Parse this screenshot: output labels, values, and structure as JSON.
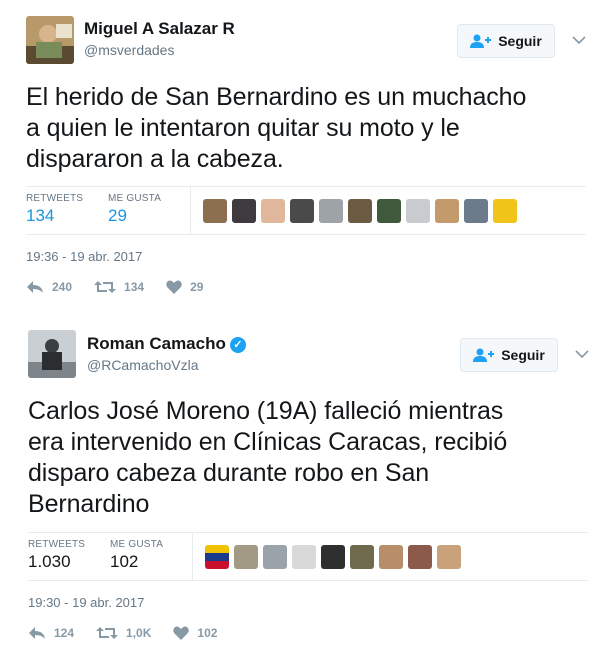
{
  "tweets": [
    {
      "name": "Miguel A Salazar R",
      "handle": "@msverdades",
      "verified": false,
      "follow_label": "Seguir",
      "text_lines": [
        "El herido de San Bernardino es un muchacho",
        "a quien le intentaron quitar su moto y le",
        "dispararon a la cabeza."
      ],
      "retweets_label": "RETWEETS",
      "retweets_value": "134",
      "likes_label": "ME GUSTA",
      "likes_value": "29",
      "date": "19:36 - 19 abr. 2017",
      "reply_count": "240",
      "retweet_count": "134",
      "like_count": "29"
    },
    {
      "name": "Roman Camacho",
      "handle": "@RCamachoVzla",
      "verified": true,
      "follow_label": "Seguir",
      "text_lines": [
        "Carlos José Moreno (19A) falleció mientras",
        "era intervenido en Clínicas Caracas, recibió",
        "disparo cabeza durante robo en San",
        "Bernardino"
      ],
      "retweets_label": "RETWEETS",
      "retweets_value": "1.030",
      "likes_label": "ME GUSTA",
      "likes_value": "102",
      "date": "19:30 - 19 abr. 2017",
      "reply_count": "124",
      "retweet_count": "1,0K",
      "like_count": "102"
    }
  ],
  "colors": {
    "accent": "#1b95e0",
    "muted": "#657786",
    "action_icon": "#8899a6",
    "verified": "#1da1f2"
  },
  "icons": {
    "follow": "person-plus-icon",
    "reply": "reply-icon",
    "retweet": "retweet-icon",
    "like": "heart-icon",
    "more": "chevron-down-icon",
    "verified": "verified-badge-icon"
  }
}
